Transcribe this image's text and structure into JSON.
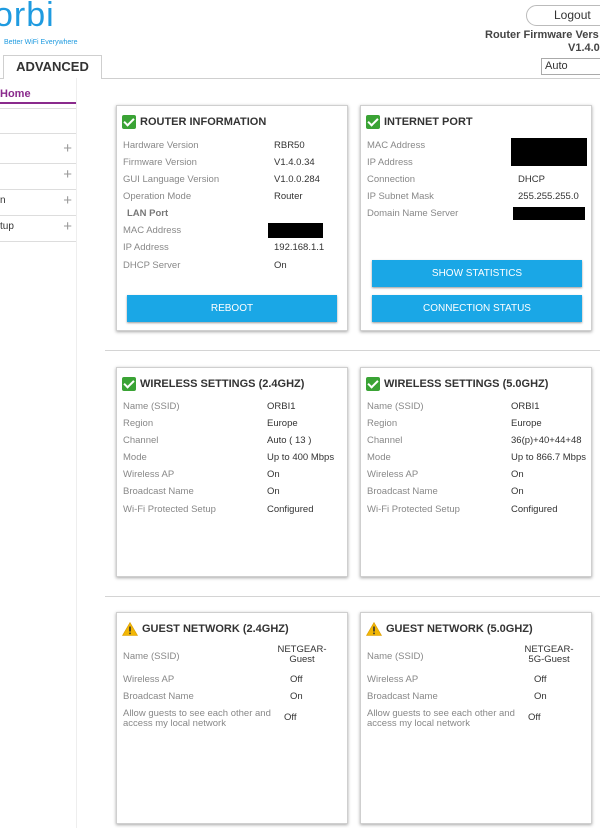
{
  "header": {
    "logo_text": "orbi",
    "logo_tagline": "Better WiFi Everywhere",
    "logout_label": "Logout",
    "firmware_label": "Router Firmware Vers",
    "firmware_version": "V1.4.0",
    "language_value": "Auto"
  },
  "tabs": {
    "advanced_label": "ADVANCED"
  },
  "sidebar": {
    "home_label": "Home",
    "items": [
      {
        "label": ""
      },
      {
        "label": ""
      },
      {
        "label": "n"
      },
      {
        "label": "tup"
      }
    ]
  },
  "router_info": {
    "title": "ROUTER INFORMATION",
    "rows": [
      {
        "label": "Hardware Version",
        "value": "RBR50"
      },
      {
        "label": "Firmware Version",
        "value": "V1.4.0.34"
      },
      {
        "label": "GUI Language Version",
        "value": "V1.0.0.284"
      },
      {
        "label": "Operation Mode",
        "value": "Router"
      }
    ],
    "lan_port_label": "LAN Port",
    "lan_rows": [
      {
        "label": "MAC Address",
        "value": ""
      },
      {
        "label": "IP Address",
        "value": "192.168.1.1"
      },
      {
        "label": "DHCP Server",
        "value": "On"
      }
    ],
    "reboot_label": "REBOOT"
  },
  "internet_port": {
    "title": "INTERNET PORT",
    "rows": [
      {
        "label": "MAC Address",
        "value": ""
      },
      {
        "label": "IP Address",
        "value": ""
      },
      {
        "label": "Connection",
        "value": "DHCP"
      },
      {
        "label": "IP Subnet Mask",
        "value": "255.255.255.0"
      },
      {
        "label": "Domain Name Server",
        "value": ""
      }
    ],
    "stats_label": "SHOW STATISTICS",
    "conn_status_label": "CONNECTION STATUS"
  },
  "wireless_24": {
    "title": "WIRELESS SETTINGS (2.4GHZ)",
    "rows": [
      {
        "label": "Name (SSID)",
        "value": "ORBI1"
      },
      {
        "label": "Region",
        "value": "Europe"
      },
      {
        "label": "Channel",
        "value": "Auto ( 13 )"
      },
      {
        "label": "Mode",
        "value": "Up to 400 Mbps"
      },
      {
        "label": "Wireless AP",
        "value": "On"
      },
      {
        "label": "Broadcast Name",
        "value": "On"
      },
      {
        "label": "Wi-Fi Protected Setup",
        "value": "Configured"
      }
    ]
  },
  "wireless_50": {
    "title": "WIRELESS SETTINGS (5.0GHZ)",
    "rows": [
      {
        "label": "Name (SSID)",
        "value": "ORBI1"
      },
      {
        "label": "Region",
        "value": "Europe"
      },
      {
        "label": "Channel",
        "value": "36(p)+40+44+48"
      },
      {
        "label": "Mode",
        "value": "Up to 866.7 Mbps"
      },
      {
        "label": "Wireless AP",
        "value": "On"
      },
      {
        "label": "Broadcast Name",
        "value": "On"
      },
      {
        "label": "Wi-Fi Protected Setup",
        "value": "Configured"
      }
    ]
  },
  "guest_24": {
    "title": "GUEST NETWORK (2.4GHZ)",
    "ssid_label": "Name (SSID)",
    "ssid_line1": "NETGEAR-",
    "ssid_line2": "Guest",
    "rows": [
      {
        "label": "Wireless AP",
        "value": "Off"
      },
      {
        "label": "Broadcast Name",
        "value": "On"
      }
    ],
    "allow_label_1": "Allow guests to see each other and",
    "allow_label_2": "access my local network",
    "allow_value": "Off"
  },
  "guest_50": {
    "title": "GUEST NETWORK (5.0GHZ)",
    "ssid_label": "Name (SSID)",
    "ssid_line1": "NETGEAR-",
    "ssid_line2": "5G-Guest",
    "rows": [
      {
        "label": "Wireless AP",
        "value": "Off"
      },
      {
        "label": "Broadcast Name",
        "value": "On"
      }
    ],
    "allow_label_1": "Allow guests to see each other and",
    "allow_label_2": "access my local network",
    "allow_value": "Off"
  },
  "colors": {
    "accent_blue": "#1aa7e6",
    "brand_blue": "#1f9be0",
    "home_purple": "#8a2a8c",
    "ok_green": "#3aa335",
    "warn_yellow": "#f2b705"
  }
}
